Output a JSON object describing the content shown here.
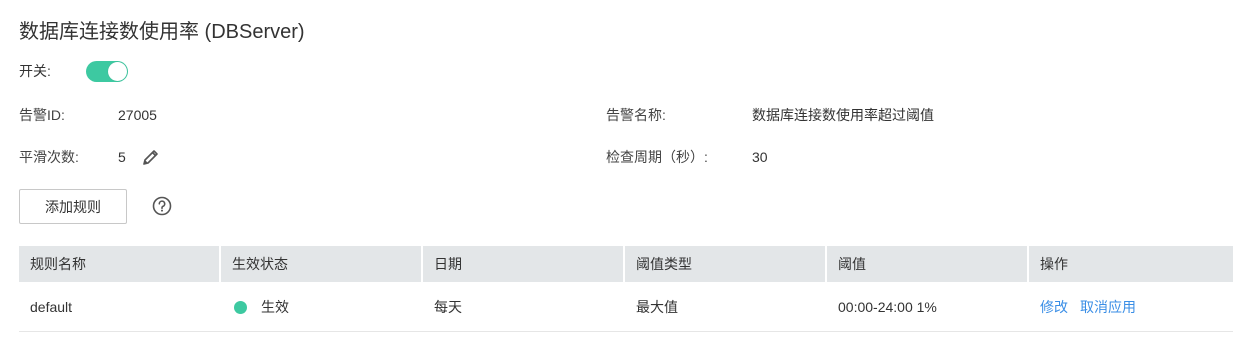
{
  "title": "数据库连接数使用率 (DBServer)",
  "switch": {
    "label": "开关:",
    "on": true,
    "color": "#3dc9a1"
  },
  "info": {
    "alarm_id_label": "告警ID:",
    "alarm_id_value": "27005",
    "alarm_name_label": "告警名称:",
    "alarm_name_value": "数据库连接数使用率超过阈值",
    "smooth_label": "平滑次数:",
    "smooth_value": "5",
    "period_label": "检查周期（秒）:",
    "period_value": "30"
  },
  "toolbar": {
    "add_rule_label": "添加规则",
    "help_icon": "question-circle-icon"
  },
  "table": {
    "headers": [
      "规则名称",
      "生效状态",
      "日期",
      "阈值类型",
      "阈值",
      "操作"
    ],
    "rows": [
      {
        "name": "default",
        "status": "生效",
        "date": "每天",
        "threshold_type": "最大值",
        "threshold": "00:00-24:00 1%",
        "actions": [
          "修改",
          "取消应用"
        ]
      }
    ]
  },
  "colors": {
    "accent": "#3dc9a1",
    "link": "#3a8ee6",
    "header_bg": "#e3e6e8"
  }
}
